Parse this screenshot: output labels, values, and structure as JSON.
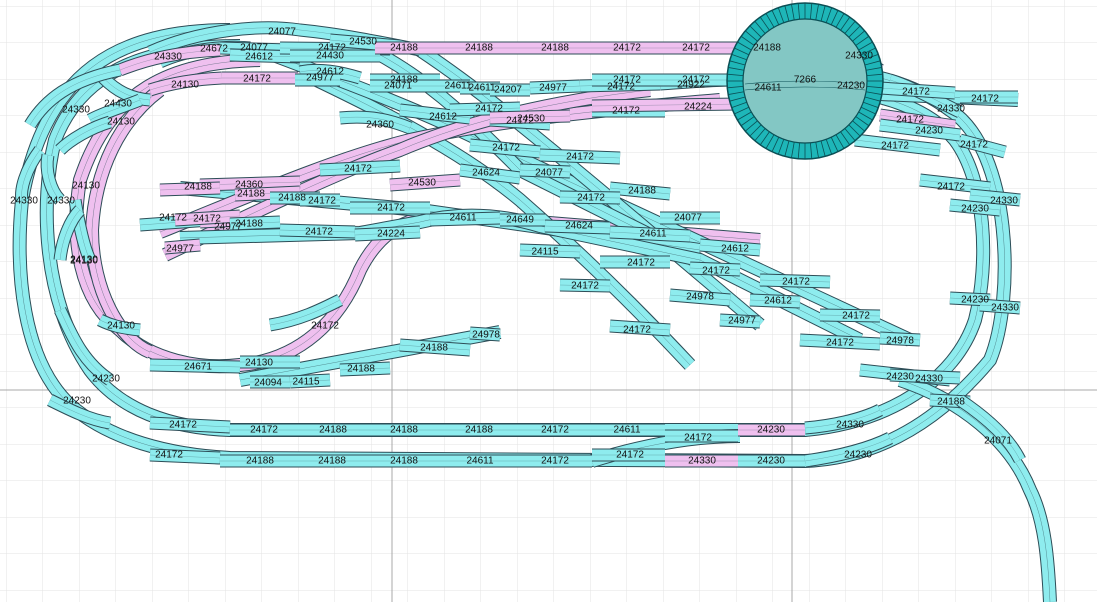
{
  "colors": {
    "background": "#ffffff",
    "grid": "#e3e3e3",
    "grid_major": "#a8a8a8",
    "track_cyan": "#8eecee",
    "track_pink": "#efc0ef",
    "track_edge": "#2d4d57",
    "turntable_fill": "#8cc9c4",
    "turntable_ring": "#1eb6b8"
  },
  "turntable": {
    "label": "7266"
  },
  "tracks": [
    {
      "label": "24077",
      "color": "cyan"
    },
    {
      "label": "24672",
      "color": "cyan"
    },
    {
      "label": "24077",
      "color": "cyan"
    },
    {
      "label": "24612",
      "color": "cyan"
    },
    {
      "label": "24172",
      "color": "cyan"
    },
    {
      "label": "24430",
      "color": "cyan"
    },
    {
      "label": "24530",
      "color": "cyan"
    },
    {
      "label": "24188",
      "color": "pink"
    },
    {
      "label": "24188",
      "color": "pink"
    },
    {
      "label": "24188",
      "color": "pink"
    },
    {
      "label": "24172",
      "color": "pink"
    },
    {
      "label": "24172",
      "color": "pink"
    },
    {
      "label": "24188",
      "color": "pink"
    },
    {
      "label": "24330",
      "color": "pink"
    },
    {
      "label": "24330",
      "color": "pink"
    },
    {
      "label": "24130",
      "color": "pink"
    },
    {
      "label": "24172",
      "color": "pink"
    },
    {
      "label": "24612",
      "color": "cyan"
    },
    {
      "label": "24977",
      "color": "cyan"
    },
    {
      "label": "24188",
      "color": "cyan"
    },
    {
      "label": "24071",
      "color": "cyan"
    },
    {
      "label": "24611",
      "color": "cyan"
    },
    {
      "label": "24611",
      "color": "cyan"
    },
    {
      "label": "24207",
      "color": "cyan"
    },
    {
      "label": "24977",
      "color": "cyan"
    },
    {
      "label": "24172",
      "color": "cyan"
    },
    {
      "label": "24922",
      "color": "cyan"
    },
    {
      "label": "24172",
      "color": "cyan"
    },
    {
      "label": "24611",
      "color": "cyan"
    },
    {
      "label": "24230",
      "color": "cyan"
    },
    {
      "label": "24172",
      "color": "cyan"
    },
    {
      "label": "24172",
      "color": "cyan"
    },
    {
      "label": "24330",
      "color": "cyan"
    },
    {
      "label": "24430",
      "color": "cyan"
    },
    {
      "label": "24330",
      "color": "cyan"
    },
    {
      "label": "24130",
      "color": "cyan"
    },
    {
      "label": "24172",
      "color": "cyan"
    },
    {
      "label": "24612",
      "color": "cyan"
    },
    {
      "label": "24172",
      "color": "cyan"
    },
    {
      "label": "24224",
      "color": "pink"
    },
    {
      "label": "24172",
      "color": "pink"
    },
    {
      "label": "24360",
      "color": "cyan"
    },
    {
      "label": "24172",
      "color": "cyan"
    },
    {
      "label": "24530",
      "color": "pink"
    },
    {
      "label": "24172",
      "color": "cyan"
    },
    {
      "label": "24172",
      "color": "cyan"
    },
    {
      "label": "24230",
      "color": "cyan"
    },
    {
      "label": "24172",
      "color": "cyan"
    },
    {
      "label": "24172",
      "color": "cyan"
    },
    {
      "label": "24130",
      "color": "cyan"
    },
    {
      "label": "24330",
      "color": "cyan"
    },
    {
      "label": "24330",
      "color": "cyan"
    },
    {
      "label": "24130",
      "color": "cyan"
    },
    {
      "label": "24172",
      "color": "cyan"
    },
    {
      "label": "24172",
      "color": "cyan"
    },
    {
      "label": "24624",
      "color": "cyan"
    },
    {
      "label": "24188",
      "color": "cyan"
    },
    {
      "label": "24360",
      "color": "pink"
    },
    {
      "label": "24188",
      "color": "pink"
    },
    {
      "label": "24188",
      "color": "cyan"
    },
    {
      "label": "24172",
      "color": "cyan"
    },
    {
      "label": "24172",
      "color": "cyan"
    },
    {
      "label": "24530",
      "color": "pink"
    },
    {
      "label": "24077",
      "color": "cyan"
    },
    {
      "label": "24172",
      "color": "cyan"
    },
    {
      "label": "24077",
      "color": "cyan"
    },
    {
      "label": "24172",
      "color": "cyan"
    },
    {
      "label": "24230",
      "color": "cyan"
    },
    {
      "label": "24330",
      "color": "cyan"
    },
    {
      "label": "24188",
      "color": "pink"
    },
    {
      "label": "24172",
      "color": "cyan"
    },
    {
      "label": "24611",
      "color": "cyan"
    },
    {
      "label": "24649",
      "color": "cyan"
    },
    {
      "label": "24624",
      "color": "cyan"
    },
    {
      "label": "24611",
      "color": "cyan"
    },
    {
      "label": "24977",
      "color": "pink"
    },
    {
      "label": "24172",
      "color": "pink"
    },
    {
      "label": "24188",
      "color": "cyan"
    },
    {
      "label": "24172",
      "color": "cyan"
    },
    {
      "label": "24224",
      "color": "cyan"
    },
    {
      "label": "24977",
      "color": "pink"
    },
    {
      "label": "24612",
      "color": "cyan"
    },
    {
      "label": "24115",
      "color": "cyan"
    },
    {
      "label": "24172",
      "color": "cyan"
    },
    {
      "label": "24172",
      "color": "cyan"
    },
    {
      "label": "24130",
      "color": "cyan"
    },
    {
      "label": "24172",
      "color": "cyan"
    },
    {
      "label": "24172",
      "color": "cyan"
    },
    {
      "label": "24612",
      "color": "cyan"
    },
    {
      "label": "24172",
      "color": "cyan"
    },
    {
      "label": "24230",
      "color": "cyan"
    },
    {
      "label": "24330",
      "color": "cyan"
    },
    {
      "label": "24977",
      "color": "cyan"
    },
    {
      "label": "24172",
      "color": "cyan"
    },
    {
      "label": "24978",
      "color": "cyan"
    },
    {
      "label": "24172",
      "color": "cyan"
    },
    {
      "label": "24130",
      "color": "cyan"
    },
    {
      "label": "24978",
      "color": "cyan"
    },
    {
      "label": "24188",
      "color": "cyan"
    },
    {
      "label": "24671",
      "color": "cyan"
    },
    {
      "label": "24130",
      "color": "cyan"
    },
    {
      "label": "24094",
      "color": "cyan"
    },
    {
      "label": "24115",
      "color": "cyan"
    },
    {
      "label": "24188",
      "color": "cyan"
    },
    {
      "label": "24978",
      "color": "cyan"
    },
    {
      "label": "24230",
      "color": "cyan"
    },
    {
      "label": "24172",
      "color": "cyan"
    },
    {
      "label": "24230",
      "color": "cyan"
    },
    {
      "label": "24330",
      "color": "cyan"
    },
    {
      "label": "24230",
      "color": "cyan"
    },
    {
      "label": "24172",
      "color": "cyan"
    },
    {
      "label": "24172",
      "color": "cyan"
    },
    {
      "label": "24188",
      "color": "cyan"
    },
    {
      "label": "24188",
      "color": "cyan"
    },
    {
      "label": "24188",
      "color": "cyan"
    },
    {
      "label": "24172",
      "color": "cyan"
    },
    {
      "label": "24611",
      "color": "cyan"
    },
    {
      "label": "24172",
      "color": "cyan"
    },
    {
      "label": "24230",
      "color": "pink"
    },
    {
      "label": "24330",
      "color": "cyan"
    },
    {
      "label": "24188",
      "color": "cyan"
    },
    {
      "label": "24172",
      "color": "cyan"
    },
    {
      "label": "24188",
      "color": "cyan"
    },
    {
      "label": "24188",
      "color": "cyan"
    },
    {
      "label": "24188",
      "color": "cyan"
    },
    {
      "label": "24611",
      "color": "cyan"
    },
    {
      "label": "24172",
      "color": "cyan"
    },
    {
      "label": "24172",
      "color": "cyan"
    },
    {
      "label": "24330",
      "color": "pink"
    },
    {
      "label": "24230",
      "color": "cyan"
    },
    {
      "label": "24230",
      "color": "cyan"
    },
    {
      "label": "24071",
      "color": "cyan"
    }
  ]
}
